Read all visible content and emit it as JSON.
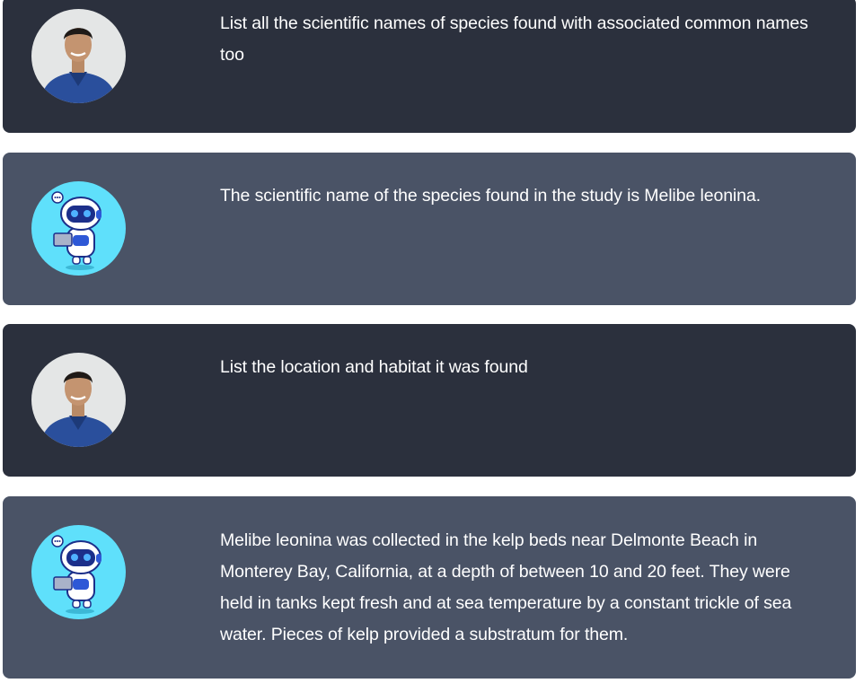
{
  "messages": [
    {
      "role": "user",
      "avatar_icon": "user-photo-avatar",
      "text": "List all the scientific names of species found with associated common names too"
    },
    {
      "role": "assistant",
      "avatar_icon": "robot-avatar",
      "text": "The scientific name of the species found in the study is Melibe leonina."
    },
    {
      "role": "user",
      "avatar_icon": "user-photo-avatar",
      "text": "List the location and habitat it was found"
    },
    {
      "role": "assistant",
      "avatar_icon": "robot-avatar",
      "text": "Melibe leonina was collected in the kelp beds near Delmonte Beach in Monterey Bay, California, at a depth of between 10 and 20 feet. They were held in tanks kept fresh and at sea temperature by a constant trickle of sea water. Pieces of kelp provided a substratum for them."
    }
  ],
  "colors": {
    "user_bg": "#2b303d",
    "assistant_bg": "#4a5366",
    "text": "#ffffff",
    "robot_bg": "#5fe0fb"
  }
}
